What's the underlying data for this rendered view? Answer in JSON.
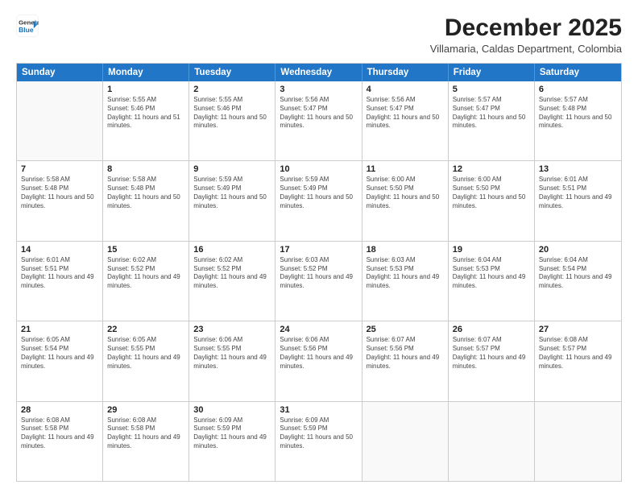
{
  "header": {
    "logo_line1": "General",
    "logo_line2": "Blue",
    "month": "December 2025",
    "location": "Villamaria, Caldas Department, Colombia"
  },
  "days_of_week": [
    "Sunday",
    "Monday",
    "Tuesday",
    "Wednesday",
    "Thursday",
    "Friday",
    "Saturday"
  ],
  "weeks": [
    [
      {
        "day": "",
        "sunrise": "",
        "sunset": "",
        "daylight": ""
      },
      {
        "day": "1",
        "sunrise": "Sunrise: 5:55 AM",
        "sunset": "Sunset: 5:46 PM",
        "daylight": "Daylight: 11 hours and 51 minutes."
      },
      {
        "day": "2",
        "sunrise": "Sunrise: 5:55 AM",
        "sunset": "Sunset: 5:46 PM",
        "daylight": "Daylight: 11 hours and 50 minutes."
      },
      {
        "day": "3",
        "sunrise": "Sunrise: 5:56 AM",
        "sunset": "Sunset: 5:47 PM",
        "daylight": "Daylight: 11 hours and 50 minutes."
      },
      {
        "day": "4",
        "sunrise": "Sunrise: 5:56 AM",
        "sunset": "Sunset: 5:47 PM",
        "daylight": "Daylight: 11 hours and 50 minutes."
      },
      {
        "day": "5",
        "sunrise": "Sunrise: 5:57 AM",
        "sunset": "Sunset: 5:47 PM",
        "daylight": "Daylight: 11 hours and 50 minutes."
      },
      {
        "day": "6",
        "sunrise": "Sunrise: 5:57 AM",
        "sunset": "Sunset: 5:48 PM",
        "daylight": "Daylight: 11 hours and 50 minutes."
      }
    ],
    [
      {
        "day": "7",
        "sunrise": "Sunrise: 5:58 AM",
        "sunset": "Sunset: 5:48 PM",
        "daylight": "Daylight: 11 hours and 50 minutes."
      },
      {
        "day": "8",
        "sunrise": "Sunrise: 5:58 AM",
        "sunset": "Sunset: 5:48 PM",
        "daylight": "Daylight: 11 hours and 50 minutes."
      },
      {
        "day": "9",
        "sunrise": "Sunrise: 5:59 AM",
        "sunset": "Sunset: 5:49 PM",
        "daylight": "Daylight: 11 hours and 50 minutes."
      },
      {
        "day": "10",
        "sunrise": "Sunrise: 5:59 AM",
        "sunset": "Sunset: 5:49 PM",
        "daylight": "Daylight: 11 hours and 50 minutes."
      },
      {
        "day": "11",
        "sunrise": "Sunrise: 6:00 AM",
        "sunset": "Sunset: 5:50 PM",
        "daylight": "Daylight: 11 hours and 50 minutes."
      },
      {
        "day": "12",
        "sunrise": "Sunrise: 6:00 AM",
        "sunset": "Sunset: 5:50 PM",
        "daylight": "Daylight: 11 hours and 50 minutes."
      },
      {
        "day": "13",
        "sunrise": "Sunrise: 6:01 AM",
        "sunset": "Sunset: 5:51 PM",
        "daylight": "Daylight: 11 hours and 49 minutes."
      }
    ],
    [
      {
        "day": "14",
        "sunrise": "Sunrise: 6:01 AM",
        "sunset": "Sunset: 5:51 PM",
        "daylight": "Daylight: 11 hours and 49 minutes."
      },
      {
        "day": "15",
        "sunrise": "Sunrise: 6:02 AM",
        "sunset": "Sunset: 5:52 PM",
        "daylight": "Daylight: 11 hours and 49 minutes."
      },
      {
        "day": "16",
        "sunrise": "Sunrise: 6:02 AM",
        "sunset": "Sunset: 5:52 PM",
        "daylight": "Daylight: 11 hours and 49 minutes."
      },
      {
        "day": "17",
        "sunrise": "Sunrise: 6:03 AM",
        "sunset": "Sunset: 5:52 PM",
        "daylight": "Daylight: 11 hours and 49 minutes."
      },
      {
        "day": "18",
        "sunrise": "Sunrise: 6:03 AM",
        "sunset": "Sunset: 5:53 PM",
        "daylight": "Daylight: 11 hours and 49 minutes."
      },
      {
        "day": "19",
        "sunrise": "Sunrise: 6:04 AM",
        "sunset": "Sunset: 5:53 PM",
        "daylight": "Daylight: 11 hours and 49 minutes."
      },
      {
        "day": "20",
        "sunrise": "Sunrise: 6:04 AM",
        "sunset": "Sunset: 5:54 PM",
        "daylight": "Daylight: 11 hours and 49 minutes."
      }
    ],
    [
      {
        "day": "21",
        "sunrise": "Sunrise: 6:05 AM",
        "sunset": "Sunset: 5:54 PM",
        "daylight": "Daylight: 11 hours and 49 minutes."
      },
      {
        "day": "22",
        "sunrise": "Sunrise: 6:05 AM",
        "sunset": "Sunset: 5:55 PM",
        "daylight": "Daylight: 11 hours and 49 minutes."
      },
      {
        "day": "23",
        "sunrise": "Sunrise: 6:06 AM",
        "sunset": "Sunset: 5:55 PM",
        "daylight": "Daylight: 11 hours and 49 minutes."
      },
      {
        "day": "24",
        "sunrise": "Sunrise: 6:06 AM",
        "sunset": "Sunset: 5:56 PM",
        "daylight": "Daylight: 11 hours and 49 minutes."
      },
      {
        "day": "25",
        "sunrise": "Sunrise: 6:07 AM",
        "sunset": "Sunset: 5:56 PM",
        "daylight": "Daylight: 11 hours and 49 minutes."
      },
      {
        "day": "26",
        "sunrise": "Sunrise: 6:07 AM",
        "sunset": "Sunset: 5:57 PM",
        "daylight": "Daylight: 11 hours and 49 minutes."
      },
      {
        "day": "27",
        "sunrise": "Sunrise: 6:08 AM",
        "sunset": "Sunset: 5:57 PM",
        "daylight": "Daylight: 11 hours and 49 minutes."
      }
    ],
    [
      {
        "day": "28",
        "sunrise": "Sunrise: 6:08 AM",
        "sunset": "Sunset: 5:58 PM",
        "daylight": "Daylight: 11 hours and 49 minutes."
      },
      {
        "day": "29",
        "sunrise": "Sunrise: 6:08 AM",
        "sunset": "Sunset: 5:58 PM",
        "daylight": "Daylight: 11 hours and 49 minutes."
      },
      {
        "day": "30",
        "sunrise": "Sunrise: 6:09 AM",
        "sunset": "Sunset: 5:59 PM",
        "daylight": "Daylight: 11 hours and 49 minutes."
      },
      {
        "day": "31",
        "sunrise": "Sunrise: 6:09 AM",
        "sunset": "Sunset: 5:59 PM",
        "daylight": "Daylight: 11 hours and 50 minutes."
      },
      {
        "day": "",
        "sunrise": "",
        "sunset": "",
        "daylight": ""
      },
      {
        "day": "",
        "sunrise": "",
        "sunset": "",
        "daylight": ""
      },
      {
        "day": "",
        "sunrise": "",
        "sunset": "",
        "daylight": ""
      }
    ]
  ]
}
